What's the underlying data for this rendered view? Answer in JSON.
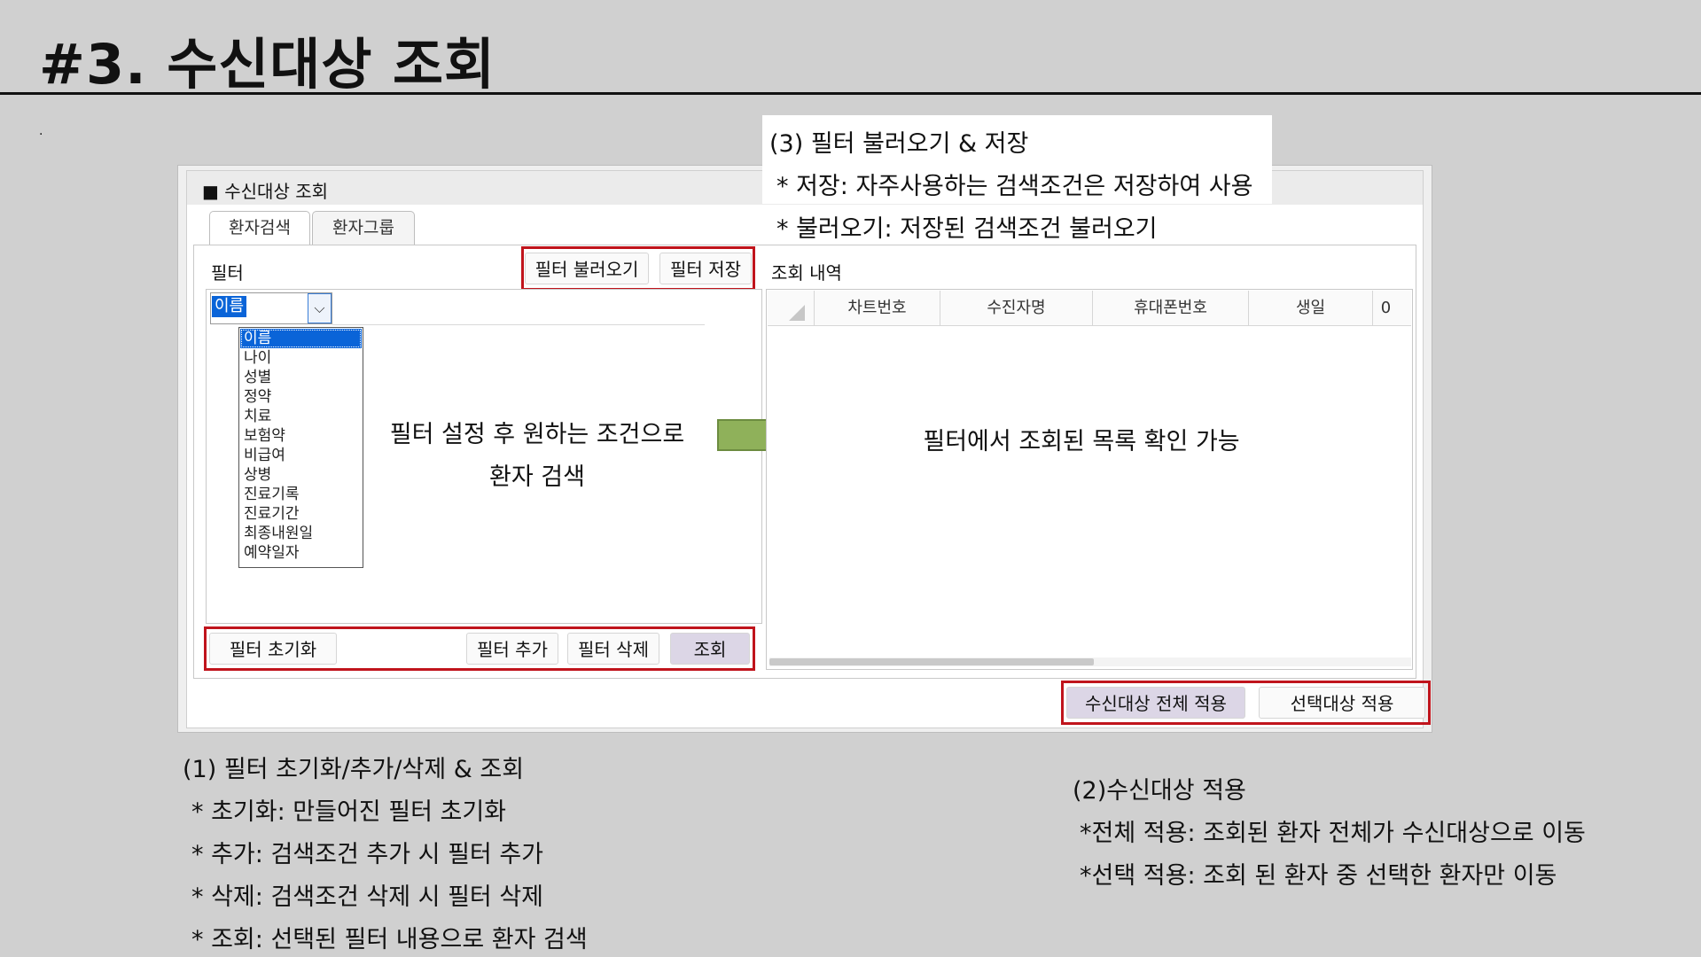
{
  "slide": {
    "title": "#3. 수신대상 조회",
    "dot": "."
  },
  "panel": {
    "title": "■ 수신대상 조회",
    "tabs": [
      {
        "label": "환자검색"
      },
      {
        "label": "환자그룹"
      }
    ],
    "filter_label": "필터",
    "result_label": "조회 내역"
  },
  "buttons": {
    "load_filter": "필터 불러오기",
    "save_filter": "필터 저장",
    "reset_filter": "필터 초기화",
    "add_filter": "필터 추가",
    "delete_filter": "필터 삭제",
    "search": "조회",
    "apply_all": "수신대상 전체 적용",
    "apply_selected": "선택대상 적용"
  },
  "filter": {
    "selected": "이름",
    "options": [
      "이름",
      "나이",
      "성별",
      "정약",
      "치료",
      "보험약",
      "비급여",
      "상병",
      "진료기록",
      "진료기간",
      "최종내원일",
      "예약일자"
    ]
  },
  "grid": {
    "columns": [
      "차트번호",
      "수진자명",
      "휴대폰번호",
      "생일",
      "0"
    ]
  },
  "overlay": {
    "left_line1": "필터 설정 후 원하는 조건으로",
    "left_line2": "환자 검색",
    "right": "필터에서 조회된 목록 확인 가능",
    "arrow_color": "#8fb15a"
  },
  "notes": {
    "n3_title": "(3) 필터 불러오기 & 저장",
    "n3_line1": "* 저장: 자주사용하는 검색조건은 저장하여 사용",
    "n3_line2": "* 불러오기: 저장된 검색조건 불러오기",
    "n1_title": "(1)  필터 초기화/추가/삭제 & 조회",
    "n1_line1": "* 초기화: 만들어진 필터  초기화",
    "n1_line2": "* 추가: 검색조건 추가 시 필터 추가",
    "n1_line3": "* 삭제: 검색조건 삭제 시 필터 삭제",
    "n1_line4": "* 조회: 선택된 필터 내용으로 환자 검색",
    "n2_title": "(2)수신대상 적용",
    "n2_line1": "*전체 적용: 조회된 환자 전체가 수신대상으로 이동",
    "n2_line2": "*선택 적용: 조회 된 환자 중 선택한 환자만 이동"
  },
  "colors": {
    "background": "#d0d0d0",
    "highlight_border": "#c0141c",
    "selection": "#0a64d8"
  }
}
